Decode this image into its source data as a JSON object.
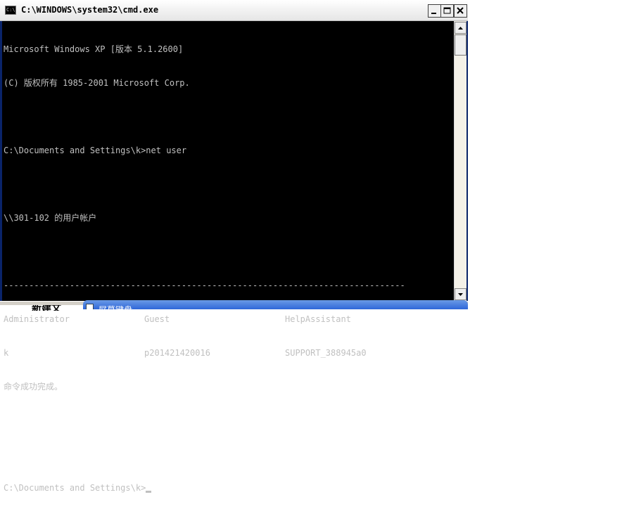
{
  "window": {
    "title": "C:\\WINDOWS\\system32\\cmd.exe",
    "icon": "cmd-icon",
    "icon_text": "C:\\"
  },
  "console": {
    "line1": "Microsoft Windows XP [版本 5.1.2600]",
    "line2": "(C) 版权所有 1985-2001 Microsoft Corp.",
    "line3": "",
    "command_line": "C:\\Documents and Settings\\k>net user",
    "line5": "",
    "accounts_header": "\\\\301-102 的用户帐户",
    "line7": "",
    "separator": "-------------------------------------------------------------------------------",
    "users": [
      [
        "Administrator",
        "Guest",
        "HelpAssistant"
      ],
      [
        "k",
        "p201421420016",
        "SUPPORT_388945a0"
      ]
    ],
    "completion": "命令成功完成。",
    "prompt": "C:\\Documents and Settings\\k>"
  },
  "colors": {
    "background": "#000000",
    "text": "#c0c0c0",
    "titlebar": "#f0f0f0"
  },
  "partial_window": {
    "title": "屏幕键盘"
  },
  "partial_left": {
    "text": "新建文"
  }
}
